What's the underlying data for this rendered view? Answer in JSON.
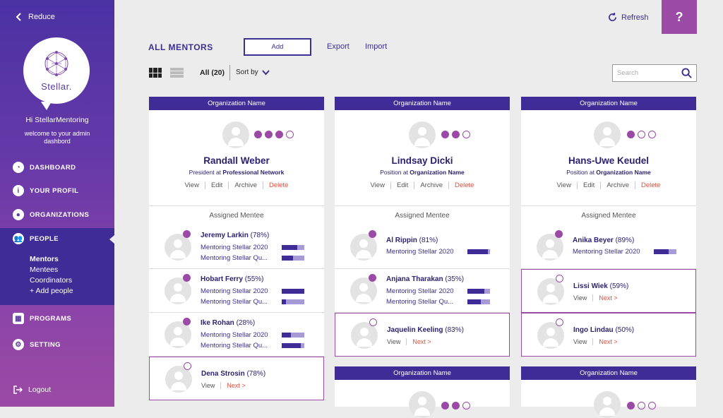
{
  "sidebar": {
    "reduce_label": "Reduce",
    "logo_text": "Stellar.",
    "greeting": "Hi StellarMentoring",
    "welcome_line1": "welcome to your admin",
    "welcome_line2": "dashbord",
    "nav": {
      "dashboard": "DASHBOARD",
      "profile": "YOUR PROFIL",
      "organizations": "ORGANIZATIONS",
      "people": "PEOPLE",
      "programs": "PROGRAMS",
      "setting": "SETTING"
    },
    "people_sub": {
      "mentors": "Mentors",
      "mentees": "Mentees",
      "coordinators": "Coordinators",
      "add": "+ Add people"
    },
    "logout": "Logout"
  },
  "header": {
    "refresh": "Refresh",
    "help": "?"
  },
  "toolbar": {
    "title": "ALL MENTORS",
    "add": "Add",
    "export": "Export",
    "import": "Import",
    "all_count": "All (20)",
    "sort_by": "Sort by",
    "search_placeholder": "Search"
  },
  "cards": [
    {
      "org": "Organization Name",
      "name": "Randall Weber",
      "pos_prefix": "President at ",
      "pos_org": "Professional Network",
      "rating": 3,
      "actions": {
        "view": "View",
        "edit": "Edit",
        "archive": "Archive",
        "delete": "Delete"
      },
      "assigned": "Assigned Mentee",
      "mentees": [
        {
          "name": "Jeremy Larkin",
          "pct": "(78%)",
          "p1": "Mentoring Stellar 2020",
          "v1": 0.7,
          "p2": "Mentoring Stellar Qu...",
          "v2": 0.5
        },
        {
          "name": "Hobart Ferry",
          "pct": "(55%)",
          "p1": "Mentoring Stellar 2020",
          "v1": 1.0,
          "p2": "Mentoring Stellar Qu...",
          "v2": 0.2
        },
        {
          "name": "Ike Rohan",
          "pct": "(28%)",
          "p1": "Mentoring Stellar 2020",
          "v1": 0.4,
          "p2": "Mentoring Stellar Qu...",
          "v2": 0.85
        },
        {
          "name": "Dena Strosin",
          "pct": "(78%)",
          "view": "View",
          "next": "Next >"
        }
      ]
    },
    {
      "org": "Organization Name",
      "name": "Lindsay Dicki",
      "pos_prefix": "Position at ",
      "pos_org": "Organization Name",
      "rating": 2,
      "actions": {
        "view": "View",
        "edit": "Edit",
        "archive": "Archive",
        "delete": "Delete"
      },
      "assigned": "Assigned Mentee",
      "mentees": [
        {
          "name": "Al Rippin",
          "pct": "(81%)",
          "p1": "Mentoring Stellar 2020",
          "v1": 0.9
        },
        {
          "name": "Anjana Tharakan",
          "pct": "(35%)",
          "p1": "Mentoring Stellar 2020",
          "v1": 0.75,
          "p2": "Mentoring Stellar Qu...",
          "v2": 0.6
        },
        {
          "name": "Jaquelin Keeling",
          "pct": "(83%)",
          "view": "View",
          "next": "Next >"
        }
      ]
    },
    {
      "org": "Organization Name",
      "name": "Hans-Uwe Keudel",
      "pos_prefix": "Position at ",
      "pos_org": "Organization Name",
      "rating": 1,
      "actions": {
        "view": "View",
        "edit": "Edit",
        "archive": "Archive",
        "delete": "Delete"
      },
      "assigned": "Assigned Mentee",
      "mentees": [
        {
          "name": "Anika Beyer",
          "pct": "(89%)",
          "p1": "Mentoring Stellar 2020",
          "v1": 0.65
        },
        {
          "name": "Lissi Wiek",
          "pct": "(59%)",
          "view": "View",
          "next": "Next >"
        },
        {
          "name": "Ingo Lindau",
          "pct": "(50%)",
          "view": "View",
          "next": "Next >"
        }
      ]
    },
    {
      "org": "Organization Name",
      "rating": 2
    },
    {
      "org": "Organization Name",
      "rating": 1
    }
  ]
}
